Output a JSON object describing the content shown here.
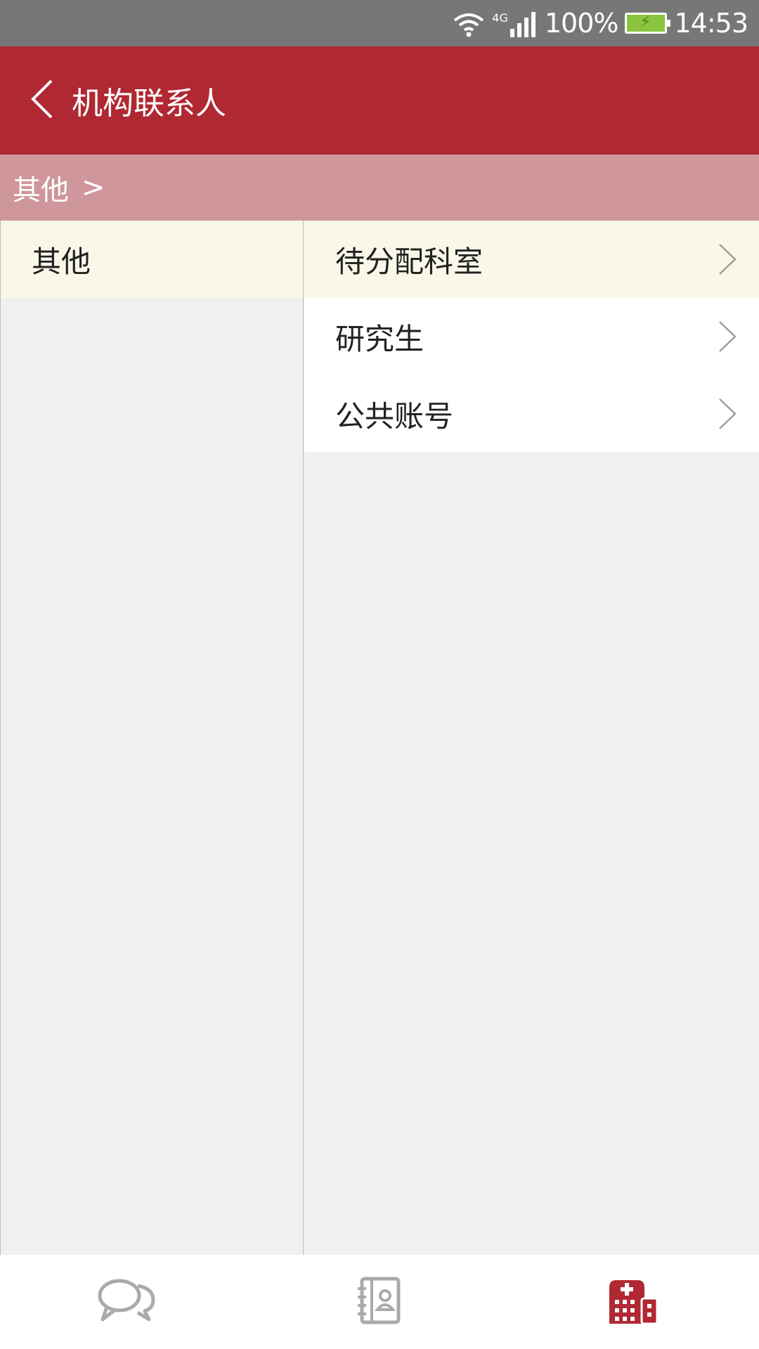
{
  "status_bar": {
    "network_type": "4G",
    "battery_percent": "100%",
    "time": "14:53",
    "icons": [
      "wifi-icon",
      "signal-icon",
      "battery-charging-icon"
    ]
  },
  "app_bar": {
    "title": "机构联系人",
    "back_icon": "chevron-left-icon",
    "background_color": "#b02832"
  },
  "breadcrumb": {
    "items": [
      "其他"
    ],
    "separator": ">"
  },
  "left_list": {
    "items": [
      {
        "label": "其他",
        "selected": true
      }
    ]
  },
  "right_list": {
    "items": [
      {
        "label": "待分配科室",
        "selected": true,
        "icon": "chevron-right-icon"
      },
      {
        "label": "研究生",
        "selected": false,
        "icon": "chevron-right-icon"
      },
      {
        "label": "公共账号",
        "selected": false,
        "icon": "chevron-right-icon"
      }
    ]
  },
  "tab_bar": {
    "tabs": [
      {
        "icon": "chat-bubbles-icon",
        "active": false
      },
      {
        "icon": "contacts-book-icon",
        "active": false
      },
      {
        "icon": "hospital-icon",
        "active": true
      }
    ],
    "active_color": "#b02832",
    "inactive_color": "#aaaaaa"
  }
}
